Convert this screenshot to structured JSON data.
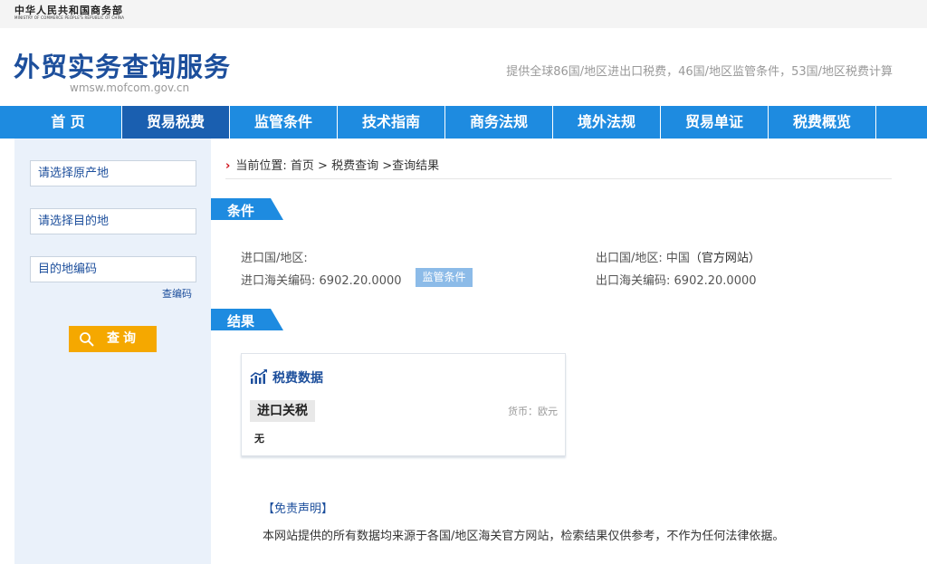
{
  "topbar": {
    "ministry_cn": "中华人民共和国商务部",
    "ministry_en": "MINISTRY OF COMMERCE PEOPLE'S REPUBLIC OF CHINA"
  },
  "header": {
    "title": "外贸实务查询服务",
    "url": "wmsw.mofcom.gov.cn",
    "tagline": "提供全球86国/地区进出口税费，46国/地区监管条件，53国/地区税费计算"
  },
  "nav": {
    "items": [
      {
        "label": "首 页"
      },
      {
        "label": "贸易税费"
      },
      {
        "label": "监管条件"
      },
      {
        "label": "技术指南"
      },
      {
        "label": "商务法规"
      },
      {
        "label": "境外法规"
      },
      {
        "label": "贸易单证"
      },
      {
        "label": "税费概览"
      }
    ],
    "active_index": 1
  },
  "sidebar": {
    "origin_placeholder": "请选择原产地",
    "destination_placeholder": "请选择目的地",
    "code_placeholder": "目的地编码",
    "lookup_link": "查编码",
    "query_button": "查询"
  },
  "breadcrumb": {
    "prefix": "当前位置:",
    "home": "首页",
    "sep": ">",
    "tax_query": "税费查询",
    "result": ">查询结果"
  },
  "conditions": {
    "section_label": "条件",
    "import_country_label": "进口国/地区:",
    "import_country_value": "",
    "import_code_label": "进口海关编码:",
    "import_code_value": "6902.20.0000",
    "supervise_button": "监管条件",
    "export_country_label": "出口国/地区:",
    "export_country_value": "中国",
    "official_site": "（官方网站）",
    "export_code_label": "出口海关编码:",
    "export_code_value": "6902.20.0000"
  },
  "results": {
    "section_label": "结果",
    "card_title": "税费数据",
    "tax_type": "进口关税",
    "currency": "货币：欧元",
    "value": "无"
  },
  "disclaimer": {
    "title": "【免责声明】",
    "text": "本网站提供的所有数据均来源于各国/地区海关官方网站，检索结果仅供参考，不作为任何法律依据。"
  },
  "colors": {
    "brand_blue": "#1d4f9c",
    "nav_blue": "#1e8be0",
    "nav_active": "#1a5fb0",
    "query_orange": "#f5a800",
    "chevron_red": "#d0121b"
  }
}
